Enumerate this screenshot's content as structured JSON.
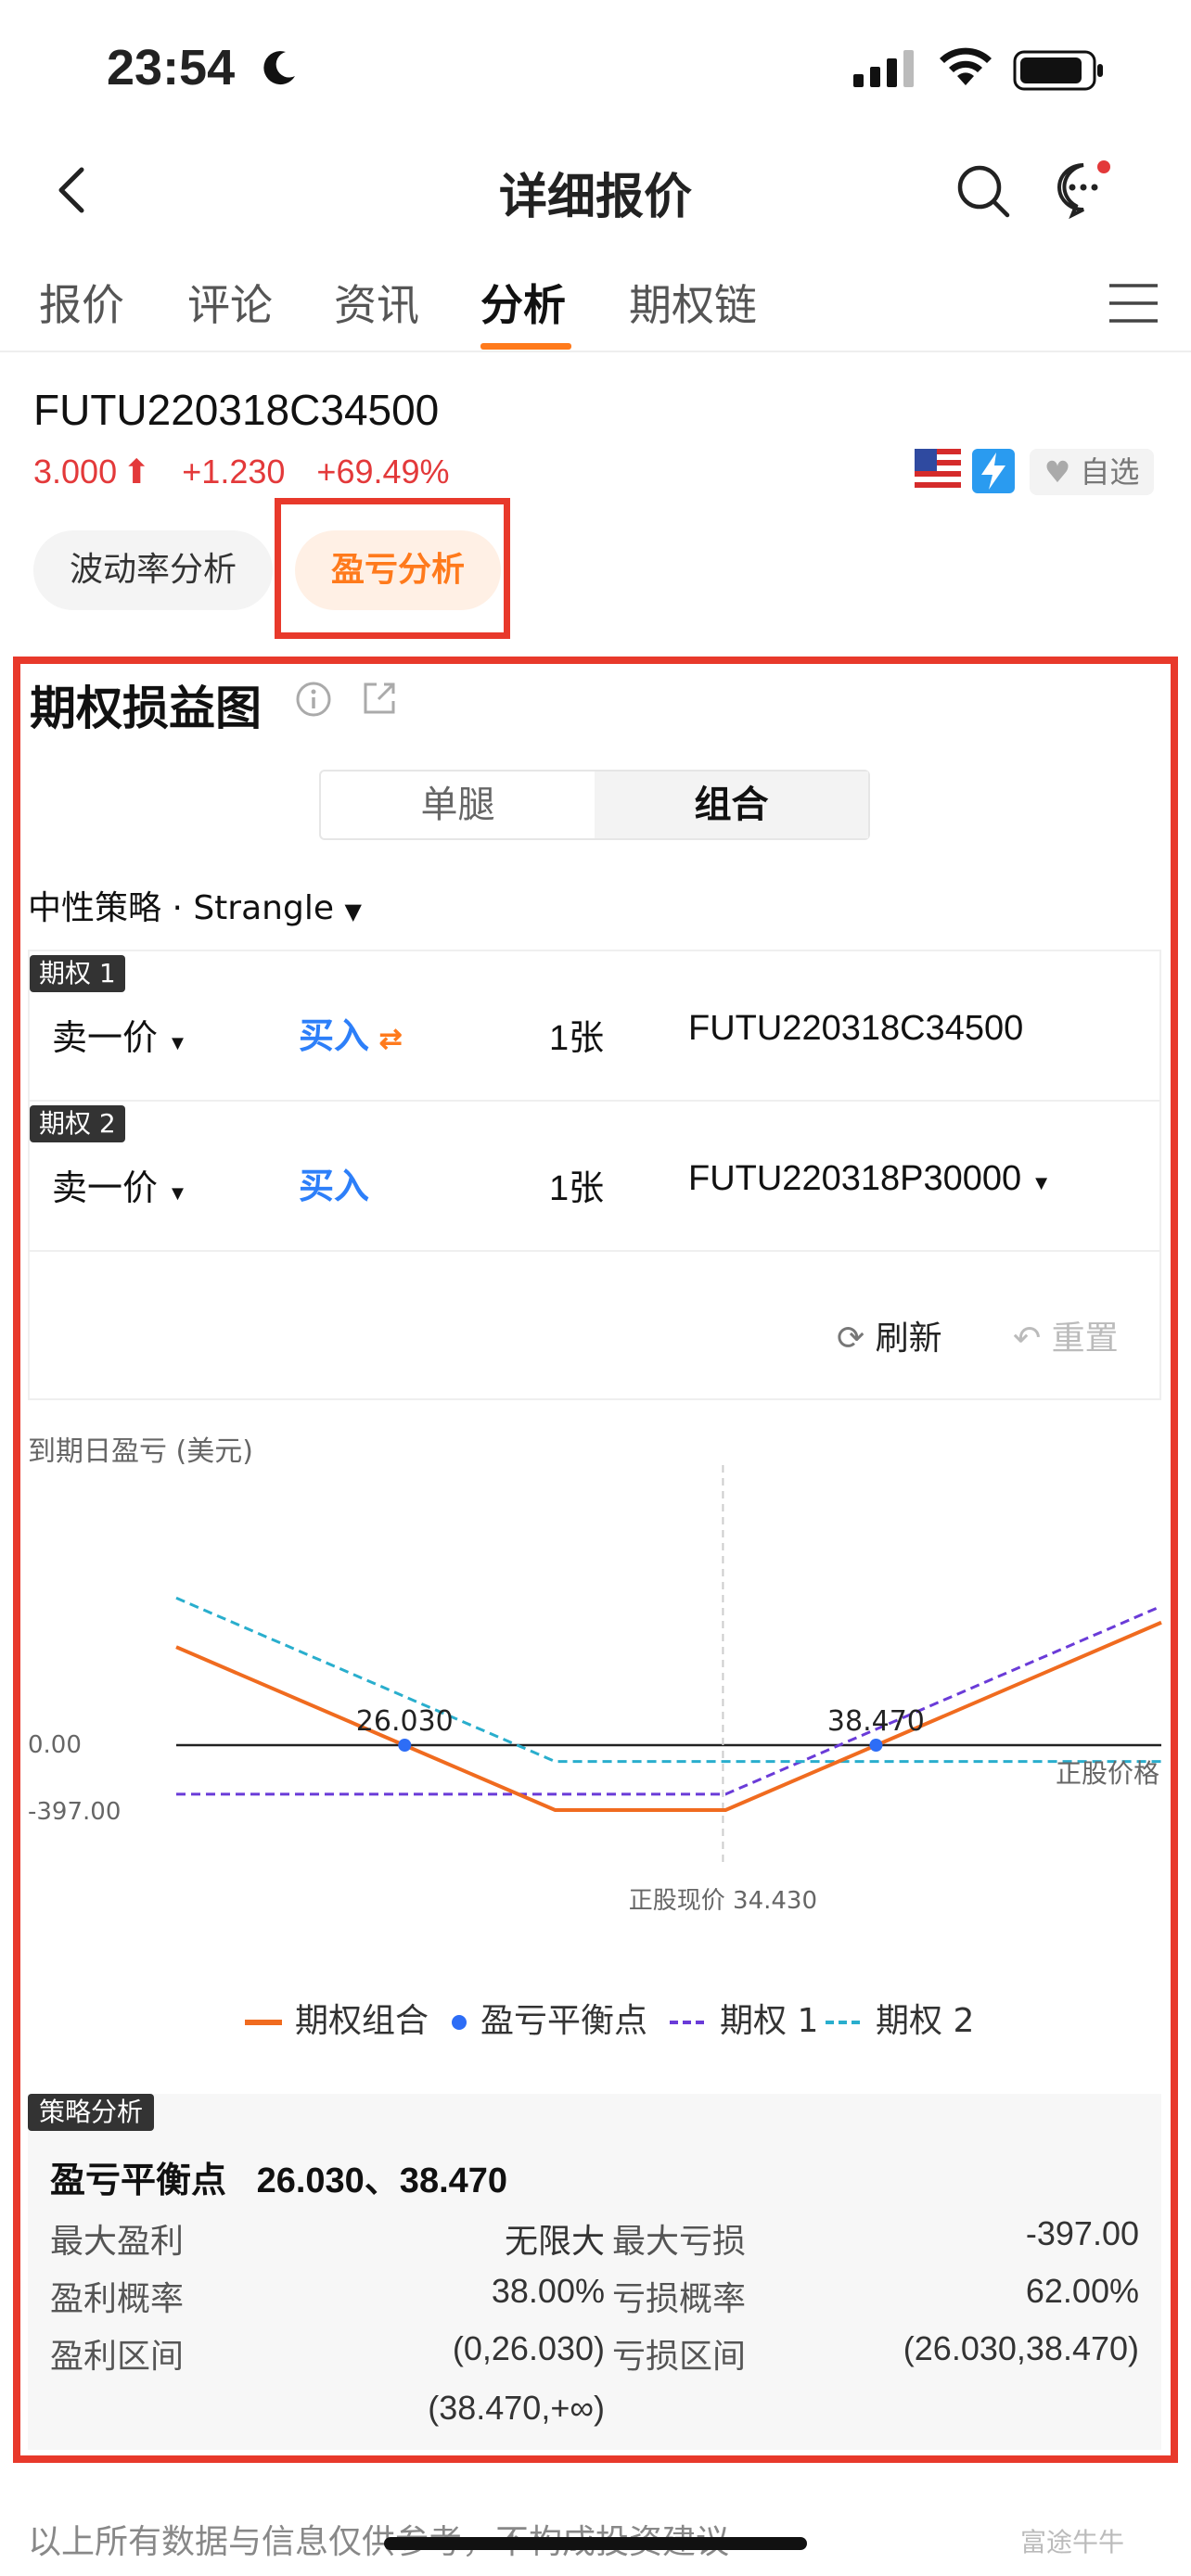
{
  "status": {
    "time": "23:54"
  },
  "nav": {
    "title": "详细报价"
  },
  "tabs": [
    {
      "label": "报价"
    },
    {
      "label": "评论"
    },
    {
      "label": "资讯"
    },
    {
      "label": "分析"
    },
    {
      "label": "期权链"
    }
  ],
  "quote": {
    "code": "FUTU220318C34500",
    "price": "3.000",
    "change": "+1.230",
    "change_pct": "+69.49%",
    "watch_label": "自选"
  },
  "subtabs": {
    "vol": "波动率分析",
    "pl": "盈亏分析"
  },
  "section": {
    "title": "期权损益图"
  },
  "segment": {
    "left": "单腿",
    "right": "组合"
  },
  "strategy": {
    "label": "中性策略 · Strangle"
  },
  "legs": [
    {
      "tag": "期权 1",
      "price_type": "卖一价",
      "action": "买入",
      "qty": "1张",
      "contract": "FUTU220318C34500"
    },
    {
      "tag": "期权 2",
      "price_type": "卖一价",
      "action": "买入",
      "qty": "1张",
      "contract": "FUTU220318P30000"
    }
  ],
  "leg_actions": {
    "refresh": "刷新",
    "reset": "重置"
  },
  "chart": {
    "ylabel": "到期日盈亏 (美元)",
    "tick_zero": "0.00",
    "tick_loss": "-397.00",
    "be_low_label": "26.030",
    "be_high_label": "38.470",
    "spot_label": "正股现价 34.430",
    "stock_price_label": "正股价格"
  },
  "legend": {
    "combo": "期权组合",
    "breakeven": "盈亏平衡点",
    "leg1": "期权 1",
    "leg2": "期权 2"
  },
  "chart_data": {
    "type": "line",
    "title": "期权损益图",
    "xlabel": "",
    "ylabel": "到期日盈亏 (美元)",
    "y_ticks": [
      0,
      -397
    ],
    "break_even": [
      26.03,
      38.47
    ],
    "spot": 34.43,
    "series": [
      {
        "name": "期权组合",
        "x": [
          20,
          30,
          34.5,
          46
        ],
        "y": [
          600,
          -397,
          -397,
          750
        ]
      },
      {
        "name": "期权 1",
        "x": [
          20,
          34.5,
          46
        ],
        "y": [
          -300,
          -300,
          850
        ]
      },
      {
        "name": "期权 2",
        "x": [
          20,
          30,
          46
        ],
        "y": [
          900,
          -100,
          -100
        ]
      }
    ]
  },
  "analysis": {
    "tag": "策略分析",
    "breakeven_label": "盈亏平衡点",
    "breakeven_value": "26.030、38.470",
    "max_profit_label": "最大盈利",
    "max_profit_value": "无限大",
    "max_loss_label": "最大亏损",
    "max_loss_value": "-397.00",
    "profit_prob_label": "盈利概率",
    "profit_prob_value": "38.00%",
    "loss_prob_label": "亏损概率",
    "loss_prob_value": "62.00%",
    "profit_range_label": "盈利区间",
    "profit_range_value_1": "(0,26.030)",
    "profit_range_value_2": "(38.470,+∞)",
    "loss_range_label": "亏损区间",
    "loss_range_value": "(26.030,38.470)"
  },
  "footer": {
    "disclaimer": "以上所有数据与信息仅供参考，不构成投资建议",
    "watermark": "富途牛牛"
  }
}
